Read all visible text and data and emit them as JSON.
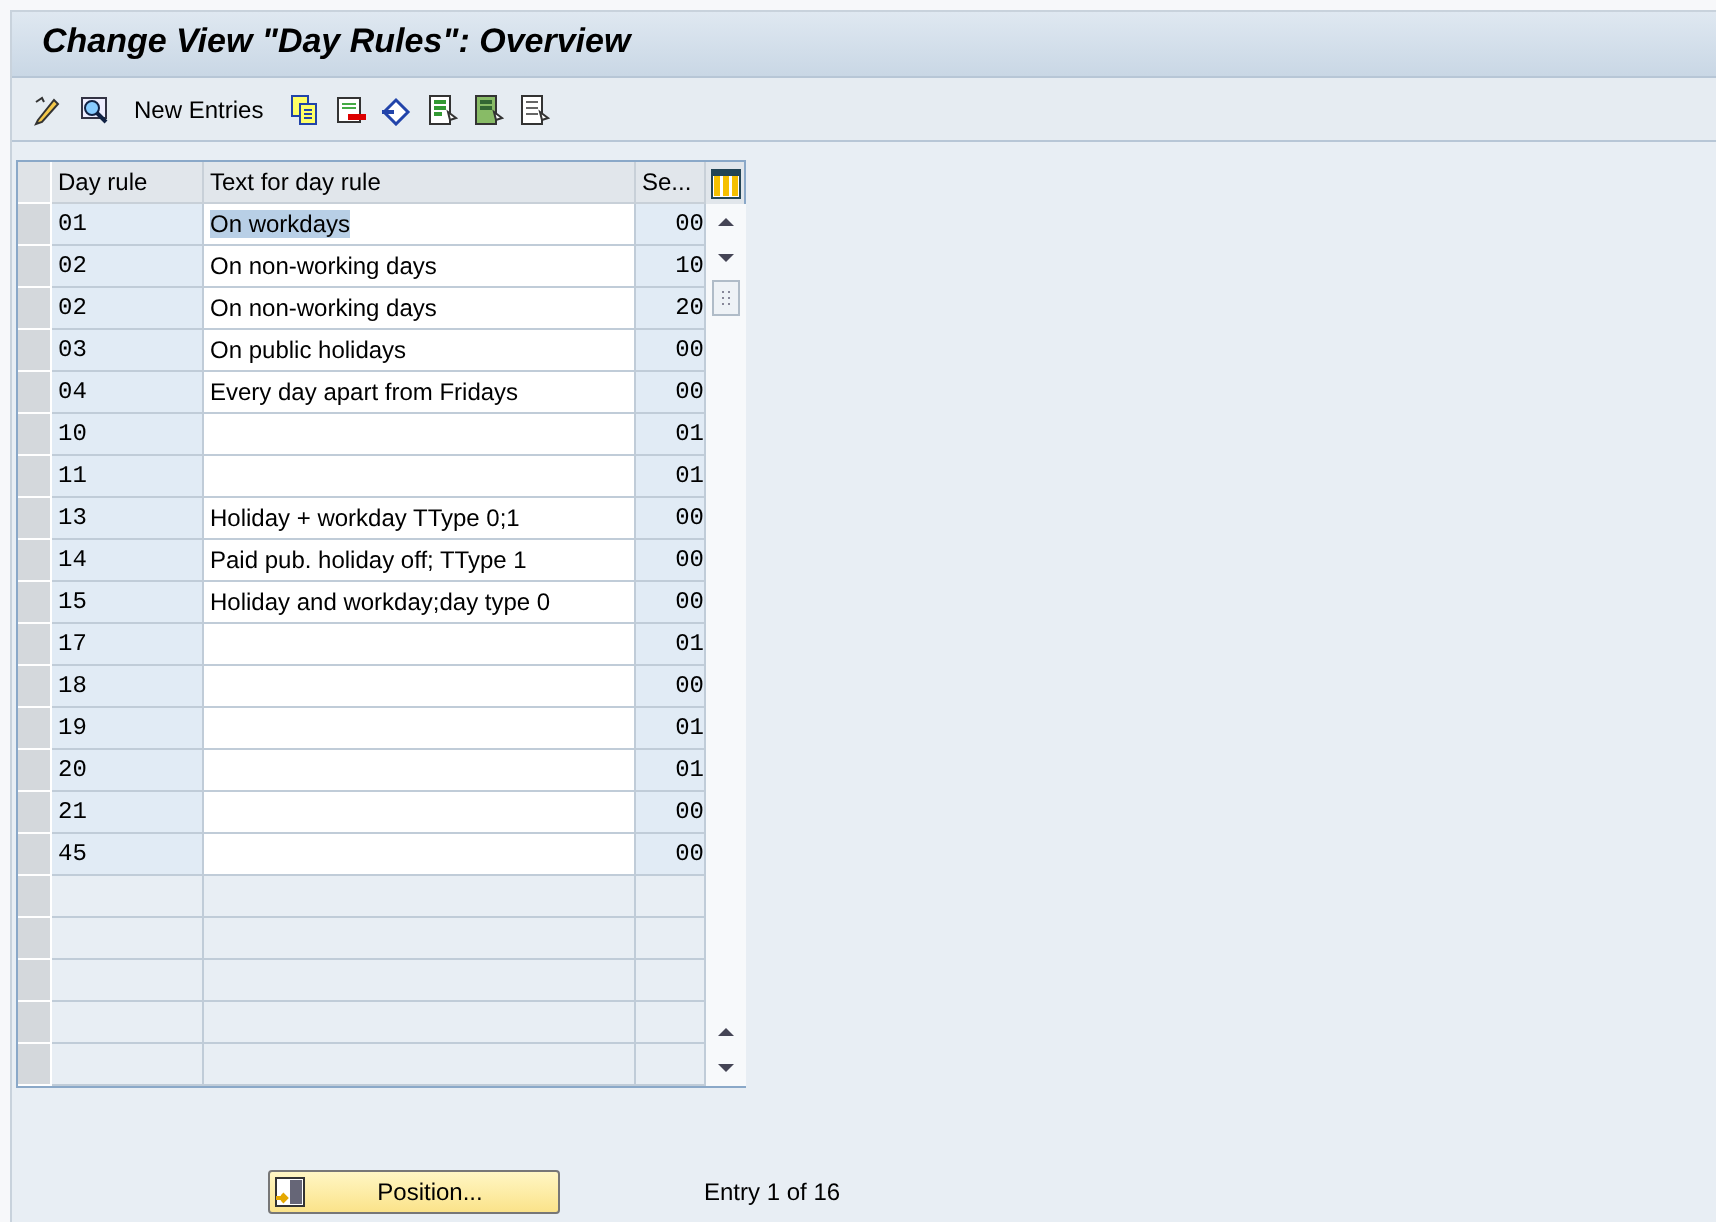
{
  "window": {
    "title": "Change View \"Day Rules\": Overview"
  },
  "toolbar": {
    "new_entries": "New Entries"
  },
  "table": {
    "columns": [
      "Day rule",
      "Text for day rule",
      "Se..."
    ],
    "rows": [
      {
        "day_rule": "01",
        "text": "On workdays",
        "column_3": "00",
        "text_selected": true
      },
      {
        "day_rule": "02",
        "text": "On non-working days",
        "column_3": "10",
        "text_selected": false
      },
      {
        "day_rule": "02",
        "text": "On non-working days",
        "column_3": "20",
        "text_selected": false
      },
      {
        "day_rule": "03",
        "text": "On public holidays",
        "column_3": "00",
        "text_selected": false
      },
      {
        "day_rule": "04",
        "text": "Every day apart from Fridays",
        "column_3": "00",
        "text_selected": false
      },
      {
        "day_rule": "10",
        "text": "",
        "column_3": "01",
        "text_selected": false
      },
      {
        "day_rule": "11",
        "text": "",
        "column_3": "01",
        "text_selected": false
      },
      {
        "day_rule": "13",
        "text": "Holiday + workday TType 0;1",
        "column_3": "00",
        "text_selected": false
      },
      {
        "day_rule": "14",
        "text": "Paid pub. holiday off; TType 1",
        "column_3": "00",
        "text_selected": false
      },
      {
        "day_rule": "15",
        "text": "Holiday and workday;day type 0",
        "column_3": "00",
        "text_selected": false
      },
      {
        "day_rule": "17",
        "text": "",
        "column_3": "01",
        "text_selected": false
      },
      {
        "day_rule": "18",
        "text": "",
        "column_3": "00",
        "text_selected": false
      },
      {
        "day_rule": "19",
        "text": "",
        "column_3": "01",
        "text_selected": false
      },
      {
        "day_rule": "20",
        "text": "",
        "column_3": "01",
        "text_selected": false
      },
      {
        "day_rule": "21",
        "text": "",
        "column_3": "00",
        "text_selected": false
      },
      {
        "day_rule": "45",
        "text": "",
        "column_3": "00",
        "text_selected": false
      }
    ]
  },
  "footer": {
    "position_button": "Position...",
    "entry_info": "Entry 1 of 16"
  }
}
